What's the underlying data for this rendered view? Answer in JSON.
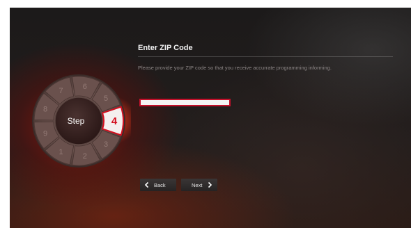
{
  "wizard": {
    "title": "Enter ZIP Code",
    "description": "Please provide your ZIP code so that you receive accurrate programming informing.",
    "zip_value": ""
  },
  "step_dial": {
    "label": "Step",
    "current_step": "4",
    "steps": [
      "1",
      "2",
      "3",
      "4",
      "5",
      "6",
      "7",
      "8",
      "9"
    ],
    "accent_color": "#d40f1f"
  },
  "nav": {
    "back_label": "Back",
    "next_label": "Next",
    "back_icon": "chevron-left-icon",
    "next_icon": "chevron-right-icon"
  }
}
